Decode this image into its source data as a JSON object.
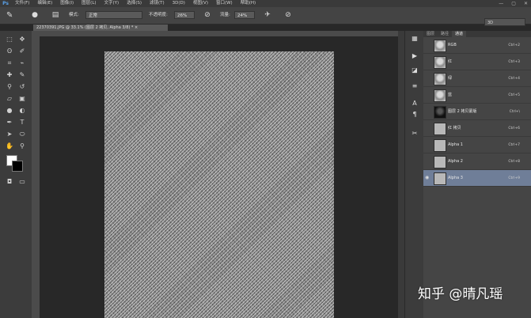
{
  "app": {
    "logo": "Ps"
  },
  "menu": [
    "文件(F)",
    "编辑(E)",
    "图像(I)",
    "图层(L)",
    "文字(Y)",
    "选择(S)",
    "滤镜(T)",
    "3D(D)",
    "视图(V)",
    "窗口(W)",
    "帮助(H)"
  ],
  "window_controls": [
    "—",
    "▢",
    "✕"
  ],
  "options": {
    "mode_label": "模式:",
    "mode_value": "正常",
    "opacity_label": "不透明度:",
    "opacity_value": "26%",
    "flow_label": "流量:",
    "flow_value": "24%",
    "workspace_value": "3D"
  },
  "document": {
    "tab_title": "22370391.JPG @ 33.1% (图层 2 拷贝, Alpha 3/8) *  ×"
  },
  "channels": {
    "tabs": [
      "图层",
      "路径",
      "通道"
    ],
    "active_tab": "通道",
    "rows": [
      {
        "name": "RGB",
        "shortcut": "Ctrl+2",
        "thumb": "face",
        "eye": "",
        "selected": false
      },
      {
        "name": "红",
        "shortcut": "Ctrl+3",
        "thumb": "face",
        "eye": "",
        "selected": false
      },
      {
        "name": "绿",
        "shortcut": "Ctrl+4",
        "thumb": "face",
        "eye": "",
        "selected": false
      },
      {
        "name": "蓝",
        "shortcut": "Ctrl+5",
        "thumb": "face",
        "eye": "",
        "selected": false
      },
      {
        "name": "图层 2 拷贝蒙版",
        "shortcut": "Ctrl+\\",
        "thumb": "dark",
        "eye": "",
        "selected": false
      },
      {
        "name": "红 拷贝",
        "shortcut": "Ctrl+6",
        "thumb": "flat",
        "eye": "",
        "selected": false
      },
      {
        "name": "Alpha 1",
        "shortcut": "Ctrl+7",
        "thumb": "flat",
        "eye": "",
        "selected": false
      },
      {
        "name": "Alpha 2",
        "shortcut": "Ctrl+8",
        "thumb": "flat",
        "eye": "",
        "selected": false
      },
      {
        "name": "Alpha 3",
        "shortcut": "Ctrl+9",
        "thumb": "flat",
        "eye": "◉",
        "selected": true
      }
    ]
  },
  "watermark": "知乎 @晴凡瑶"
}
